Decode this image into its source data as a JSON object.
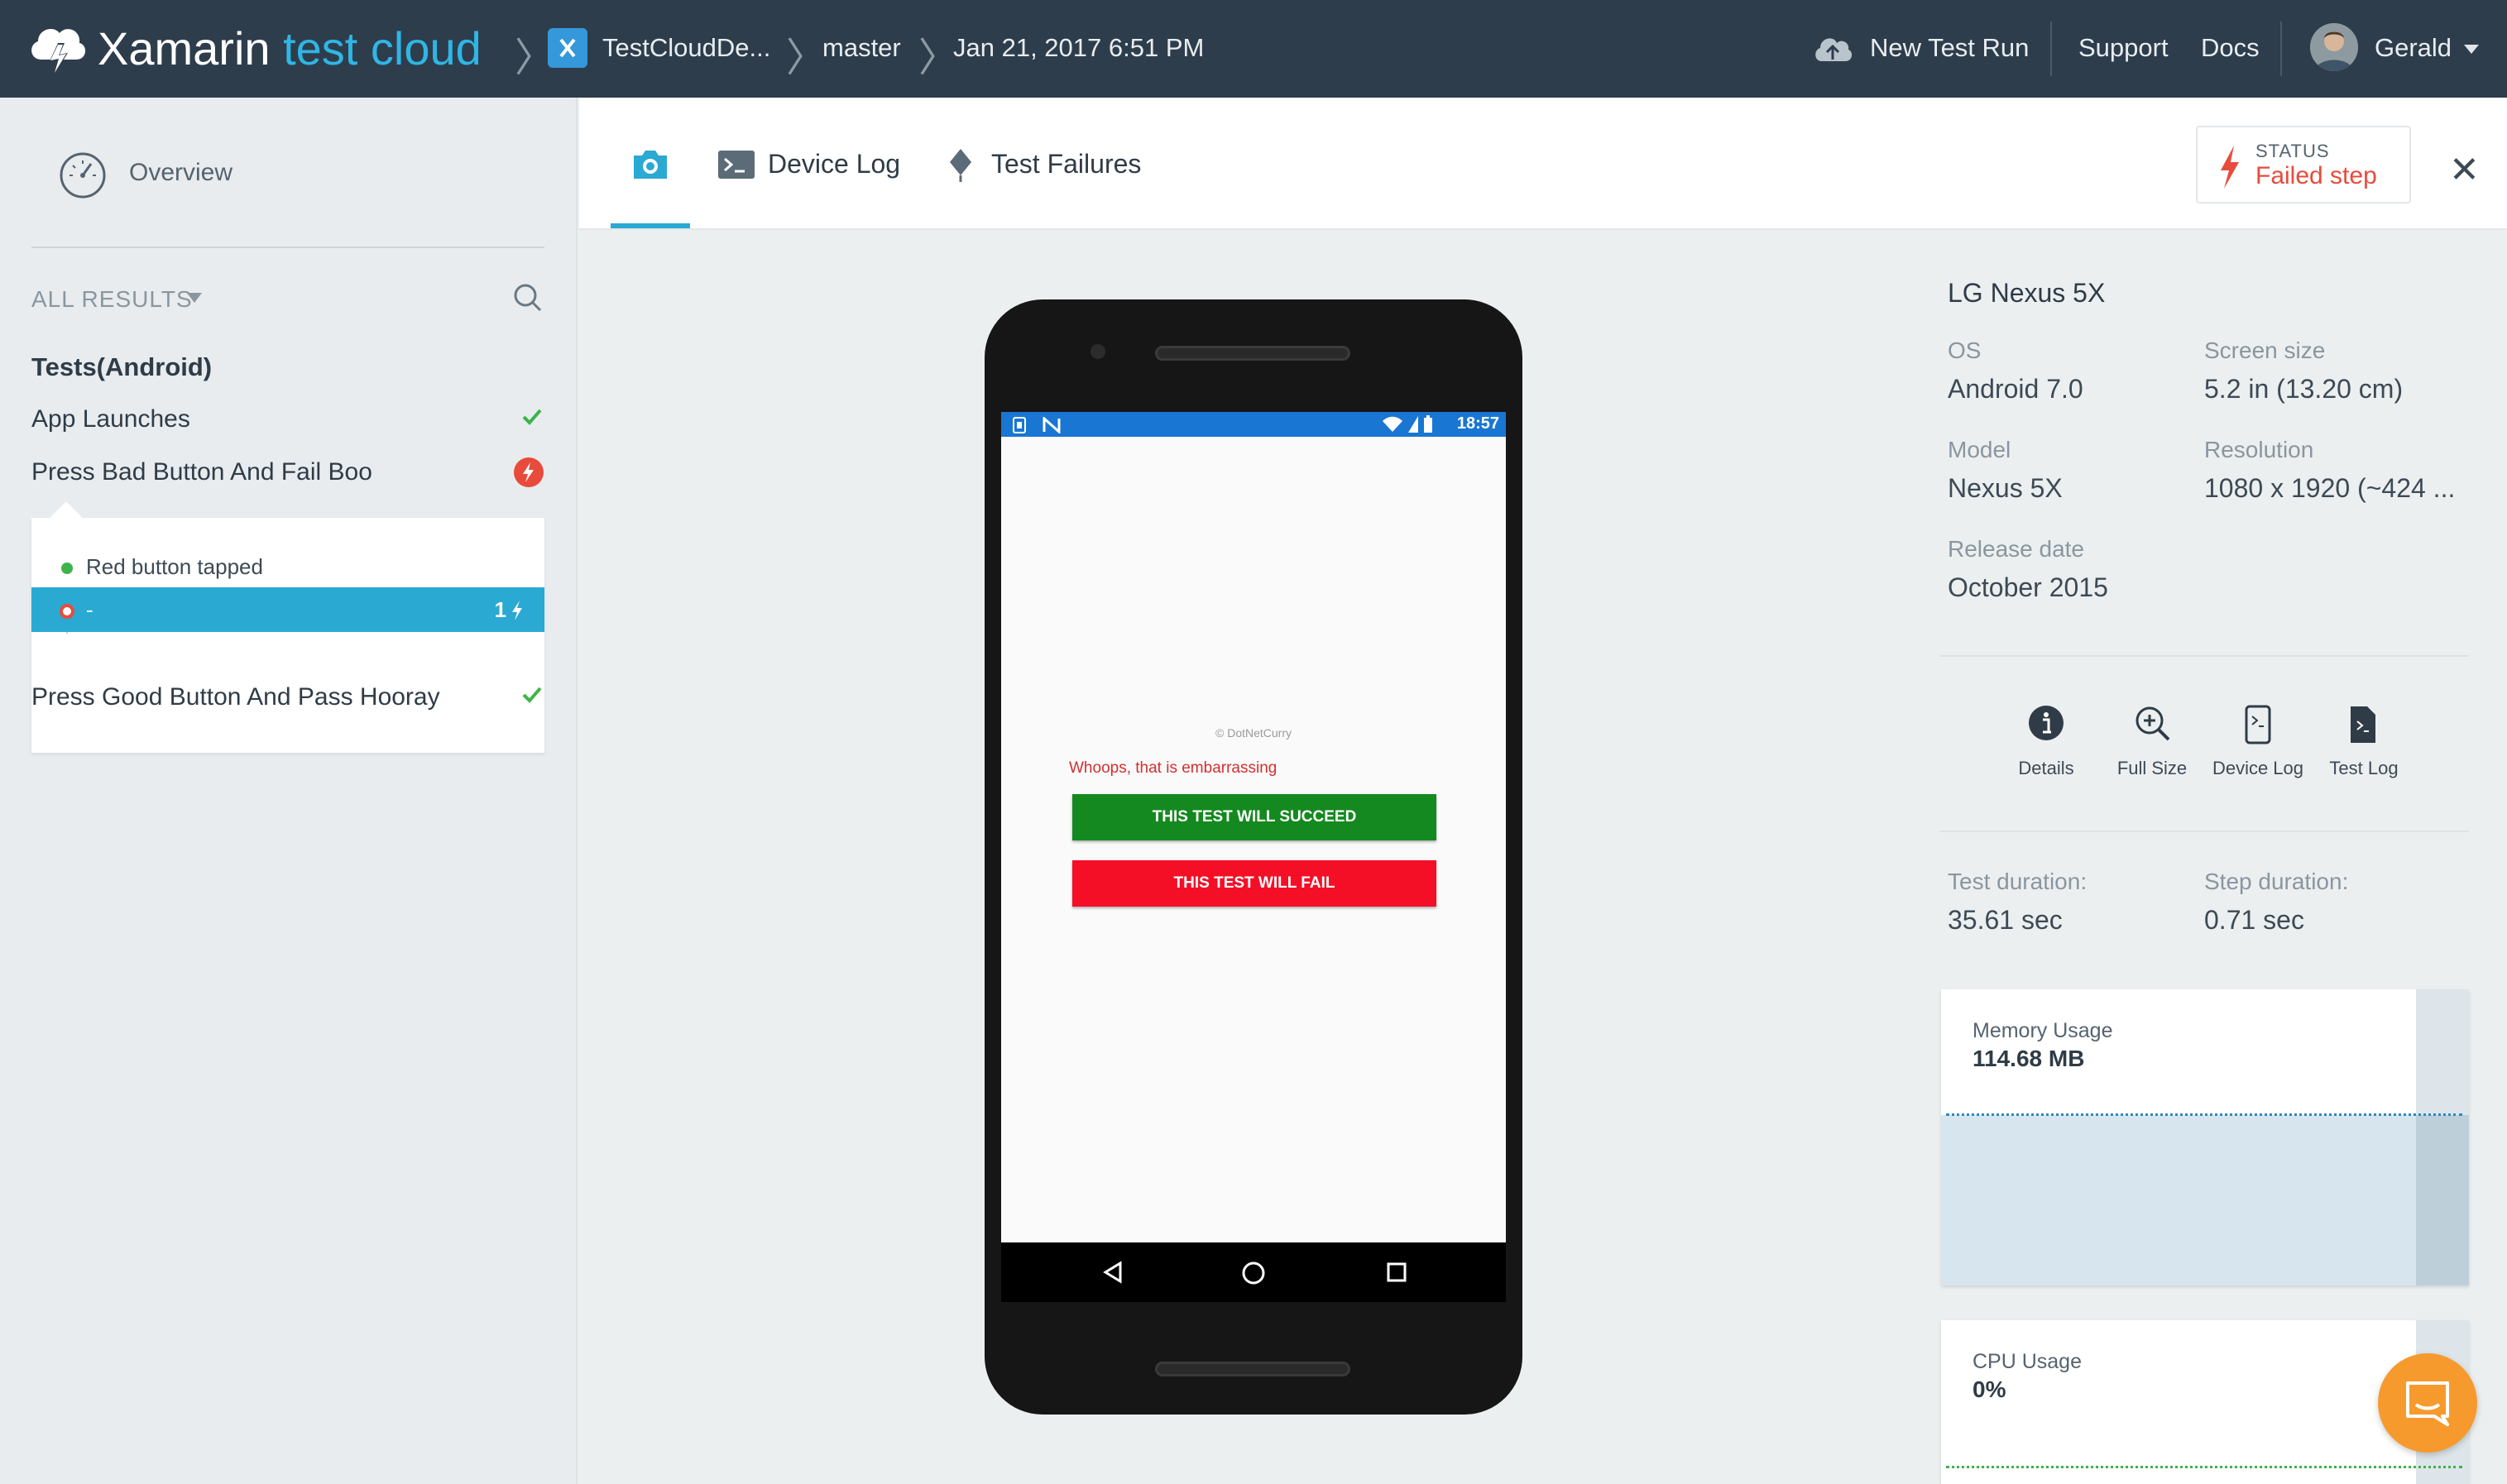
{
  "topbar": {
    "brand_main": "Xamarin",
    "brand_sub": "test cloud",
    "app_name": "TestCloudDe...",
    "branch": "master",
    "run_time": "Jan 21, 2017 6:51 PM",
    "new_test_run": "New Test Run",
    "support": "Support",
    "docs": "Docs",
    "user_name": "Gerald"
  },
  "sidebar": {
    "overview": "Overview",
    "all_results": "ALL RESULTS",
    "group_title": "Tests(Android)",
    "tests": [
      {
        "label": "App Launches",
        "status": "passed"
      },
      {
        "label": "Press Bad Button And Fail Boo",
        "status": "failed"
      },
      {
        "label": "Press Good Button And Pass Hooray",
        "status": "passed"
      }
    ],
    "steps": [
      {
        "label": "Red button tapped",
        "status": "passed"
      },
      {
        "label": "-",
        "status": "failed",
        "badge": "1"
      }
    ]
  },
  "tabs": {
    "screenshot": "",
    "device_log": "Device Log",
    "test_failures": "Test Failures"
  },
  "status": {
    "caption": "STATUS",
    "value": "Failed step"
  },
  "phone": {
    "time": "18:57",
    "copyright": "© DotNetCurry",
    "message": "Whoops, that is embarrassing",
    "btn_success": "THIS TEST WILL SUCCEED",
    "btn_fail": "THIS TEST WILL FAIL"
  },
  "device": {
    "name": "LG Nexus 5X",
    "os_label": "OS",
    "os_value": "Android 7.0",
    "screen_label": "Screen size",
    "screen_value": "5.2 in (13.20 cm)",
    "model_label": "Model",
    "model_value": "Nexus 5X",
    "resolution_label": "Resolution",
    "resolution_value": "1080 x 1920 (~424 ...",
    "release_label": "Release date",
    "release_value": "October 2015"
  },
  "actions": {
    "details": "Details",
    "full_size": "Full Size",
    "device_log": "Device Log",
    "test_log": "Test Log"
  },
  "durations": {
    "test_label": "Test duration:",
    "test_value": "35.61 sec",
    "step_label": "Step duration:",
    "step_value": "0.71 sec"
  },
  "usage": {
    "memory_title": "Memory Usage",
    "memory_value": "114.68 MB",
    "cpu_title": "CPU Usage",
    "cpu_value": "0%"
  },
  "colors": {
    "topbar": "#2e3d4c",
    "accent": "#2aa9d3",
    "failed": "#e84b3c",
    "passed": "#3cb44a",
    "brand_sub": "#2fb6e5",
    "chat": "#f79a2e"
  }
}
